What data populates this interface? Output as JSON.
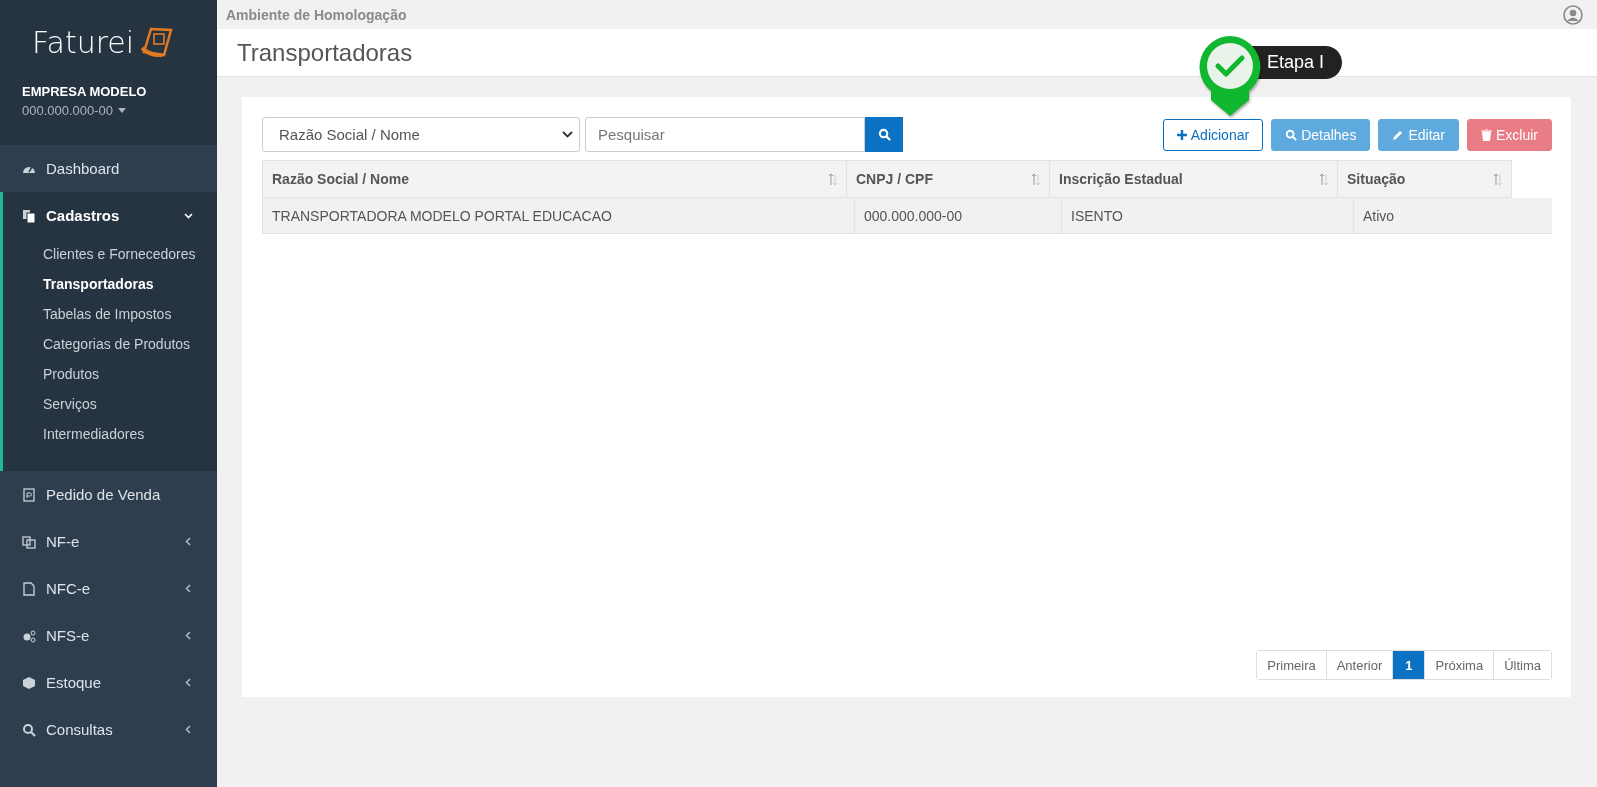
{
  "header": {
    "environment": "Ambiente de Homologação"
  },
  "page_title": "Transportadoras",
  "sidebar": {
    "logo": "Faturei",
    "company": "EMPRESA MODELO",
    "document": "000.000.000-00",
    "menu": [
      {
        "label": "Dashboard",
        "kind": "link"
      },
      {
        "label": "Cadastros",
        "kind": "group",
        "expanded": true,
        "children": [
          {
            "label": "Clientes e Fornecedores",
            "selected": false
          },
          {
            "label": "Transportadoras",
            "selected": true
          },
          {
            "label": "Tabelas de Impostos",
            "selected": false
          },
          {
            "label": "Categorias de Produtos",
            "selected": false
          },
          {
            "label": "Produtos",
            "selected": false
          },
          {
            "label": "Serviços",
            "selected": false
          },
          {
            "label": "Intermediadores",
            "selected": false
          }
        ]
      },
      {
        "label": "Pedido de Venda",
        "kind": "link"
      },
      {
        "label": "NF-e",
        "kind": "group",
        "expanded": false
      },
      {
        "label": "NFC-e",
        "kind": "group",
        "expanded": false
      },
      {
        "label": "NFS-e",
        "kind": "group",
        "expanded": false
      },
      {
        "label": "Estoque",
        "kind": "group",
        "expanded": false
      },
      {
        "label": "Consultas",
        "kind": "group",
        "expanded": false
      }
    ]
  },
  "search": {
    "field": "Razão Social / Nome",
    "placeholder": "Pesquisar"
  },
  "actions": [
    {
      "label": "Adicionar",
      "kind": "add"
    },
    {
      "label": "Detalhes",
      "kind": "details"
    },
    {
      "label": "Editar",
      "kind": "edit"
    },
    {
      "label": "Excluir",
      "kind": "delete"
    }
  ],
  "tour": {
    "label": "Etapa I"
  },
  "table": {
    "columns": [
      "Razão Social / Nome",
      "CNPJ / CPF",
      "Inscrição Estadual",
      "Situação"
    ],
    "rows": [
      [
        "TRANSPORTADORA MODELO PORTAL EDUCACAO",
        "000.000.000-00",
        "ISENTO",
        "Ativo"
      ]
    ]
  },
  "pagination": [
    {
      "label": "Primeira",
      "selected": false
    },
    {
      "label": "Anterior",
      "selected": false
    },
    {
      "label": "1",
      "selected": true
    },
    {
      "label": "Próxima",
      "selected": false
    },
    {
      "label": "Última",
      "selected": false
    }
  ]
}
